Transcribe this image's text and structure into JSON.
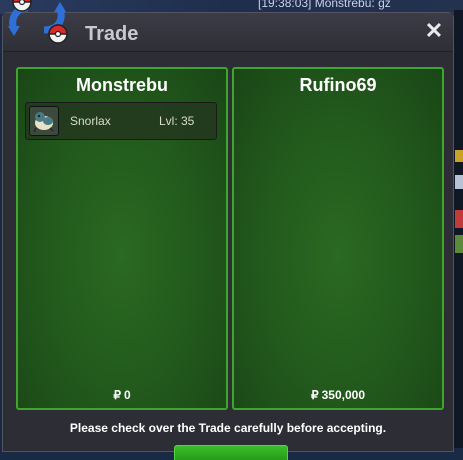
{
  "background": {
    "chat_line": "[19:38:03] Monstrebu: gz"
  },
  "window": {
    "title": "Trade",
    "close_label": "✕"
  },
  "trade": {
    "left": {
      "player": "Monstrebu",
      "items": [
        {
          "name": "Snorlax",
          "level": "Lvl: 35",
          "icon": "snorlax-icon"
        }
      ],
      "currency_symbol": "₽",
      "money": "0"
    },
    "right": {
      "player": "Rufino69",
      "items": [],
      "currency_symbol": "₽",
      "money": "350,000"
    }
  },
  "notice": "Please check over the Trade carefully before accepting.",
  "colors": {
    "panel_border": "#3fa52f",
    "panel_fill": "#22581c",
    "window_bg": "#2d2d35",
    "accept_button": "#2fae22"
  }
}
